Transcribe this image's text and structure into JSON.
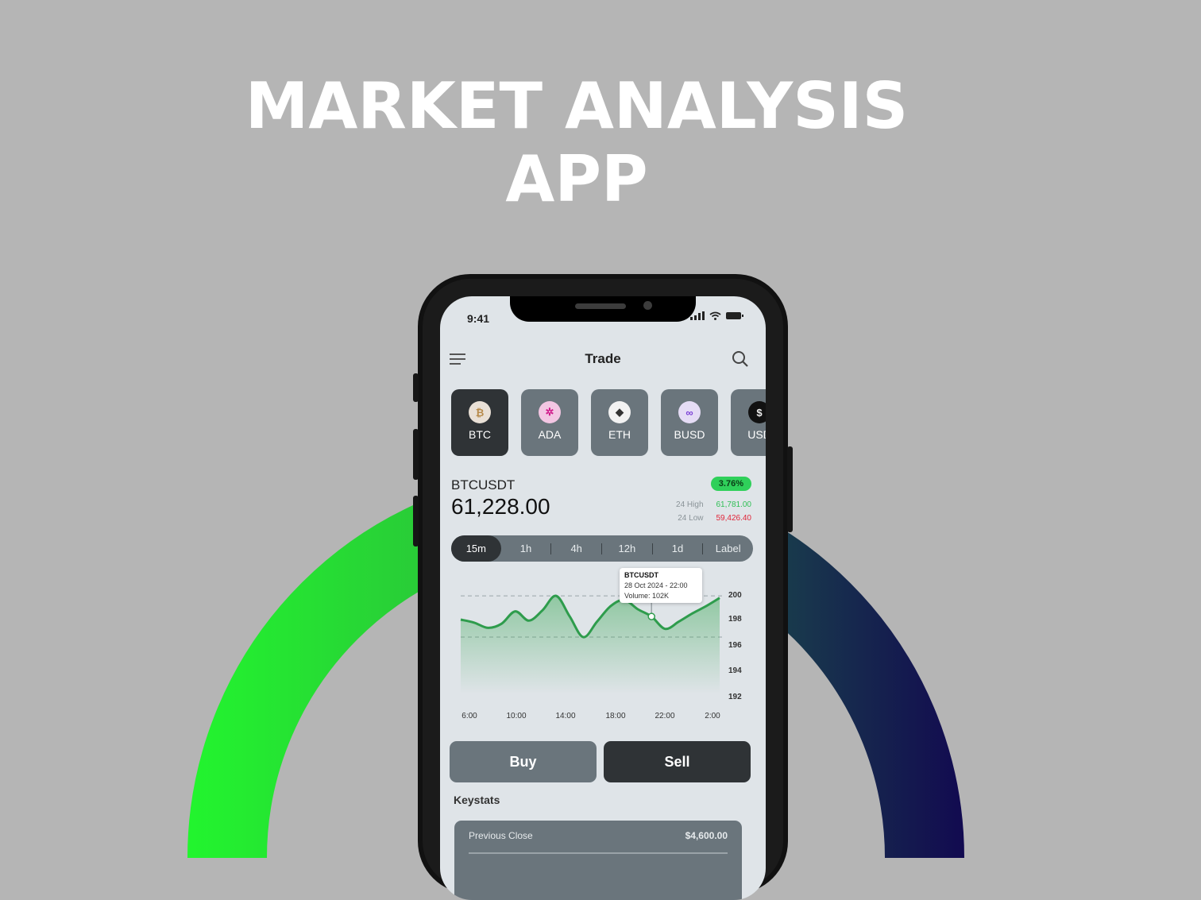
{
  "hero": {
    "line1": "MARKET ANALYSIS",
    "line2": "APP"
  },
  "colors": {
    "background": "#b5b5b5",
    "ring_start": "#22f52e",
    "ring_end": "#120a50",
    "accent_green": "#2fd05a",
    "accent_red": "#e0263a"
  },
  "status_bar": {
    "time": "9:41",
    "icons": [
      "signal-icon",
      "wifi-icon",
      "battery-icon"
    ]
  },
  "topbar": {
    "title": "Trade",
    "menu_icon": "menu-icon",
    "search_icon": "search-icon"
  },
  "coins": [
    {
      "symbol": "BTC",
      "icon": "bitcoin-icon",
      "active": true
    },
    {
      "symbol": "ADA",
      "icon": "cardano-icon",
      "active": false
    },
    {
      "symbol": "ETH",
      "icon": "ethereum-icon",
      "active": false
    },
    {
      "symbol": "BUSD",
      "icon": "busd-icon",
      "active": false
    },
    {
      "symbol": "USD",
      "icon": "usd-icon",
      "active": false
    }
  ],
  "ticker": {
    "pair": "BTCUSDT",
    "price": "61,228.00",
    "change": "3.76%",
    "high_label": "24 High",
    "high_value": "61,781.00",
    "low_label": "24 Low",
    "low_value": "59,426.40"
  },
  "timeframes": [
    "15m",
    "1h",
    "4h",
    "12h",
    "1d",
    "Label"
  ],
  "active_timeframe": "15m",
  "tooltip": {
    "title": "BTCUSDT",
    "date": "28 Oct 2024 - 22:00",
    "volume": "Volume: 102K"
  },
  "chart_data": {
    "type": "area",
    "x_ticks": [
      "6:00",
      "10:00",
      "14:00",
      "18:00",
      "22:00",
      "2:00"
    ],
    "y_ticks": [
      "200",
      "198",
      "196",
      "194",
      "192"
    ],
    "ylim": [
      192,
      200
    ],
    "series": [
      {
        "values": [
          197.7,
          197.4,
          196.9,
          197.3,
          198.5,
          197.6,
          198.6,
          200.0,
          198.0,
          196.0,
          197.5,
          199.0,
          199.6,
          198.7,
          198.0,
          196.8,
          197.5,
          198.3,
          199.0,
          199.8
        ]
      }
    ],
    "highlight_index": 14,
    "grid": true
  },
  "actions": {
    "buy": "Buy",
    "sell": "Sell"
  },
  "keystats": {
    "title": "Keystats",
    "rows": [
      {
        "label": "Previous Close",
        "value": "$4,600.00"
      }
    ]
  }
}
